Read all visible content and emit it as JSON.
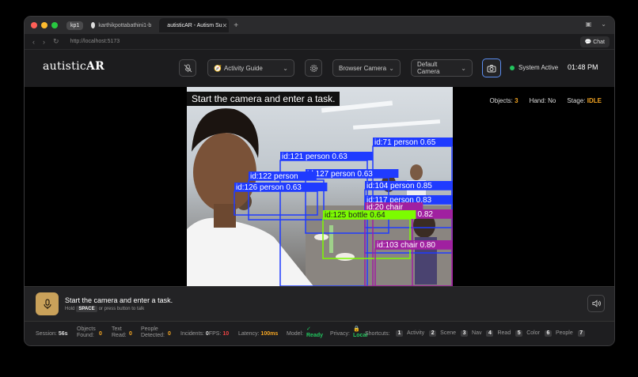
{
  "browser": {
    "profile": "kp1",
    "tabs": [
      {
        "label": "karthikpottabathini1-b"
      },
      {
        "label": "autisticAR - Autism Su"
      }
    ],
    "url": "http://localhost:5173",
    "chat_label": "Chat"
  },
  "header": {
    "brand_main": "autistic",
    "brand_accent": "AR",
    "guide_select": "Activity Guide",
    "camera_source": "Browser Camera",
    "camera_device": "Default Camera",
    "status": "System Active",
    "time": "01:48 PM"
  },
  "stage": {
    "caption": "Start the camera and enter a task.",
    "objects_label": "Objects:",
    "objects_value": "3",
    "hand_label": "Hand:",
    "hand_value": "No",
    "stage_label": "Stage:",
    "stage_value": "IDLE"
  },
  "detections": [
    {
      "label": "id:71 person 0.65",
      "color": "#1f3bff"
    },
    {
      "label": "id:121 person 0.63",
      "color": "#1f3bff"
    },
    {
      "label": "id:127 person 0.63",
      "color": "#1f3bff"
    },
    {
      "label": "id:122 person",
      "color": "#1f3bff"
    },
    {
      "label": "id:126 person 0.63",
      "color": "#1f3bff"
    },
    {
      "label": "id:104 person 0.85",
      "color": "#1f3bff"
    },
    {
      "label": "id:117 person 0.83",
      "color": "#1f3bff"
    },
    {
      "label": "id:20 chair",
      "color": "#a020a0"
    },
    {
      "label": "id:123 chair 0.82",
      "color": "#a020a0"
    },
    {
      "label": "id:125 bottle 0.64",
      "color": "#7cfc00"
    },
    {
      "label": "id:103 chair 0.80",
      "color": "#a020a0"
    }
  ],
  "assistant": {
    "prompt": "Start the camera and enter a task.",
    "hint_pre": "Hold",
    "hint_key": "SPACE",
    "hint_post": "or press button to talk"
  },
  "footer": {
    "session_label": "Session:",
    "session_value": "56s",
    "objects_label": "Objects Found:",
    "objects_value": "0",
    "text_label": "Text Read:",
    "text_value": "0",
    "people_label": "People Detected:",
    "people_value": "0",
    "incidents_label": "Incidents:",
    "incidents_value": "0",
    "fps_label": "FPS:",
    "fps_value": "10",
    "latency_label": "Latency:",
    "latency_value": "100ms",
    "model_label": "Model:",
    "model_value": "Ready",
    "privacy_label": "Privacy:",
    "privacy_value": "Local",
    "shortcuts_label": "Shortcuts:",
    "shortcuts": [
      {
        "key": "1",
        "label": "Activity"
      },
      {
        "key": "2",
        "label": "Scene"
      },
      {
        "key": "3",
        "label": "Nav"
      },
      {
        "key": "4",
        "label": "Read"
      },
      {
        "key": "5",
        "label": "Color"
      },
      {
        "key": "6",
        "label": "People"
      },
      {
        "key": "7",
        "label": ""
      }
    ]
  },
  "colors": {
    "accent": "#f5a623",
    "active": "#22c55e",
    "fps_value": "#ef4444",
    "mic": "#c9a15a"
  }
}
